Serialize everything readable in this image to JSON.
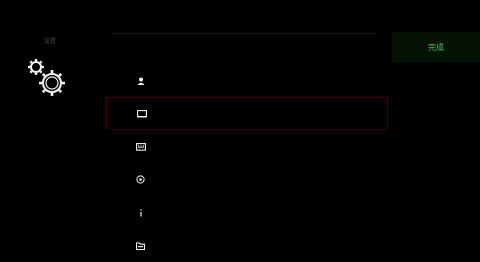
{
  "header": {
    "app_title": "设置"
  },
  "menu": {
    "caption": "",
    "items": [
      {
        "icon": "user-icon",
        "label": ""
      },
      {
        "icon": "display-icon",
        "label": ""
      },
      {
        "icon": "keyboard-icon",
        "label": ""
      },
      {
        "icon": "target-icon",
        "label": ""
      },
      {
        "icon": "info-icon",
        "label": ""
      },
      {
        "icon": "folder-icon",
        "label": ""
      }
    ],
    "selected_index": 1
  },
  "actions": {
    "confirm_label": "完成"
  },
  "colors": {
    "background": "#000000",
    "icon": "#e8e8e8",
    "selection_border": "#4a0000",
    "confirm_text": "#4cc04c",
    "confirm_bg": "#031203"
  }
}
